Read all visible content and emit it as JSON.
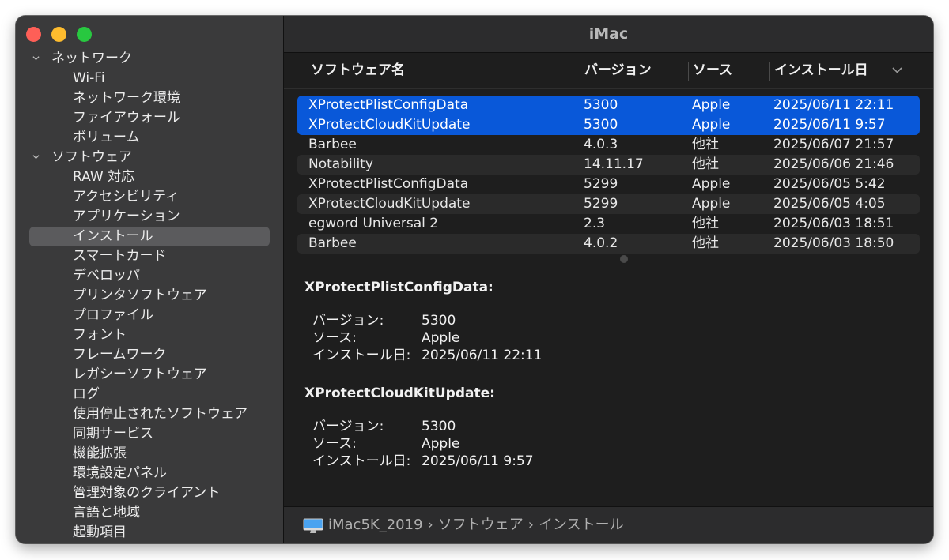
{
  "window": {
    "title": "iMac"
  },
  "colors": {
    "accent": "#0958d9",
    "close": "#fe5f57",
    "minimize": "#febc2e",
    "maximize": "#28c840"
  },
  "sidebar": {
    "sections": [
      {
        "label": "ネットワーク",
        "items": [
          "Wi-Fi",
          "ネットワーク環境",
          "ファイアウォール",
          "ボリューム"
        ]
      },
      {
        "label": "ソフトウェア",
        "items": [
          "RAW 対応",
          "アクセシビリティ",
          "アプリケーション",
          "インストール",
          "スマートカード",
          "デベロッパ",
          "プリンタソフトウェア",
          "プロファイル",
          "フォント",
          "フレームワーク",
          "レガシーソフトウェア",
          "ログ",
          "使用停止されたソフトウェア",
          "同期サービス",
          "機能拡張",
          "環境設定パネル",
          "管理対象のクライアント",
          "言語と地域",
          "起動項目"
        ]
      }
    ],
    "selected": "インストール"
  },
  "table": {
    "headers": [
      "ソフトウェア名",
      "バージョン",
      "ソース",
      "インストール日"
    ],
    "rows": [
      [
        "XProtectPlistConfigData",
        "5300",
        "Apple",
        "2025/06/11 22:11"
      ],
      [
        "XProtectCloudKitUpdate",
        "5300",
        "Apple",
        "2025/06/11 9:57"
      ],
      [
        "Barbee",
        "4.0.3",
        "他社",
        "2025/06/07 21:57"
      ],
      [
        "Notability",
        "14.11.17",
        "他社",
        "2025/06/06 21:46"
      ],
      [
        "XProtectPlistConfigData",
        "5299",
        "Apple",
        "2025/06/05 5:42"
      ],
      [
        "XProtectCloudKitUpdate",
        "5299",
        "Apple",
        "2025/06/05 4:05"
      ],
      [
        "egword Universal 2",
        "2.3",
        "他社",
        "2025/06/03 18:51"
      ],
      [
        "Barbee",
        "4.0.2",
        "他社",
        "2025/06/03 18:50"
      ]
    ]
  },
  "detail": [
    {
      "title": "XProtectPlistConfigData:",
      "fields": [
        [
          "バージョン:",
          "5300"
        ],
        [
          "ソース:",
          "Apple"
        ],
        [
          "インストール日:",
          "2025/06/11 22:11"
        ]
      ]
    },
    {
      "title": "XProtectCloudKitUpdate:",
      "fields": [
        [
          "バージョン:",
          "5300"
        ],
        [
          "ソース:",
          "Apple"
        ],
        [
          "インストール日:",
          "2025/06/11 9:57"
        ]
      ]
    }
  ],
  "pathbar": {
    "icon": "imac-icon",
    "crumbs": [
      "iMac5K_2019",
      "ソフトウェア",
      "インストール"
    ]
  }
}
